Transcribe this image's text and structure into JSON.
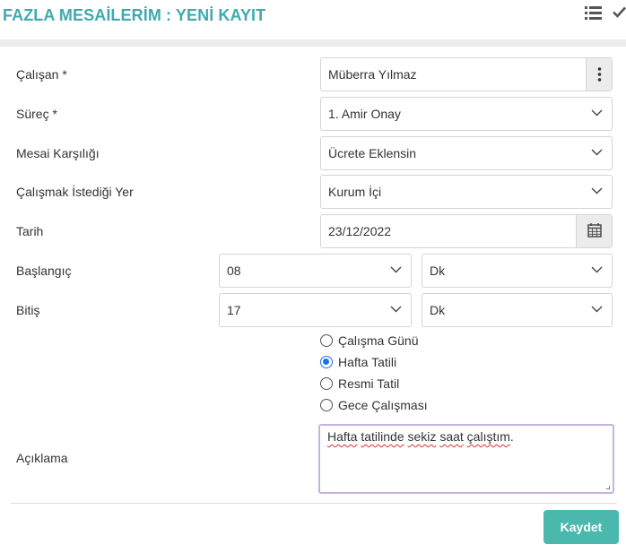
{
  "header": {
    "title": "FAZLA MESAİLERİM : YENİ KAYIT",
    "list_icon": "list-icon",
    "check_icon": "check-icon"
  },
  "form": {
    "calisan": {
      "label": "Çalışan *",
      "value": "Müberra Yılmaz"
    },
    "surec": {
      "label": "Süreç *",
      "value": "1. Amir Onay"
    },
    "mesai_karsiligi": {
      "label": "Mesai Karşılığı",
      "value": "Ücrete Eklensin"
    },
    "calismak_istedigi_yer": {
      "label": "Çalışmak İstediği Yer",
      "value": "Kurum İçi"
    },
    "tarih": {
      "label": "Tarih",
      "value": "23/12/2022"
    },
    "baslangic": {
      "label": "Başlangıç",
      "hour": "08",
      "minute": "Dk"
    },
    "bitis": {
      "label": "Bitiş",
      "hour": "17",
      "minute": "Dk"
    },
    "day_type": {
      "options": [
        "Çalışma Günü",
        "Hafta Tatili",
        "Resmi Tatil",
        "Gece Çalışması"
      ],
      "selected": "Hafta Tatili"
    },
    "aciklama": {
      "label": "Açıklama",
      "words": [
        "Hafta",
        "tatilinde",
        "sekiz",
        "saat",
        "çalıştım"
      ],
      "end_punct": "."
    }
  },
  "actions": {
    "save_label": "Kaydet"
  },
  "colors": {
    "accent": "#3fa9b1",
    "save_button": "#4bb8ae",
    "radio_selected": "#1a73e8",
    "textarea_focus": "#c5b3e0"
  }
}
